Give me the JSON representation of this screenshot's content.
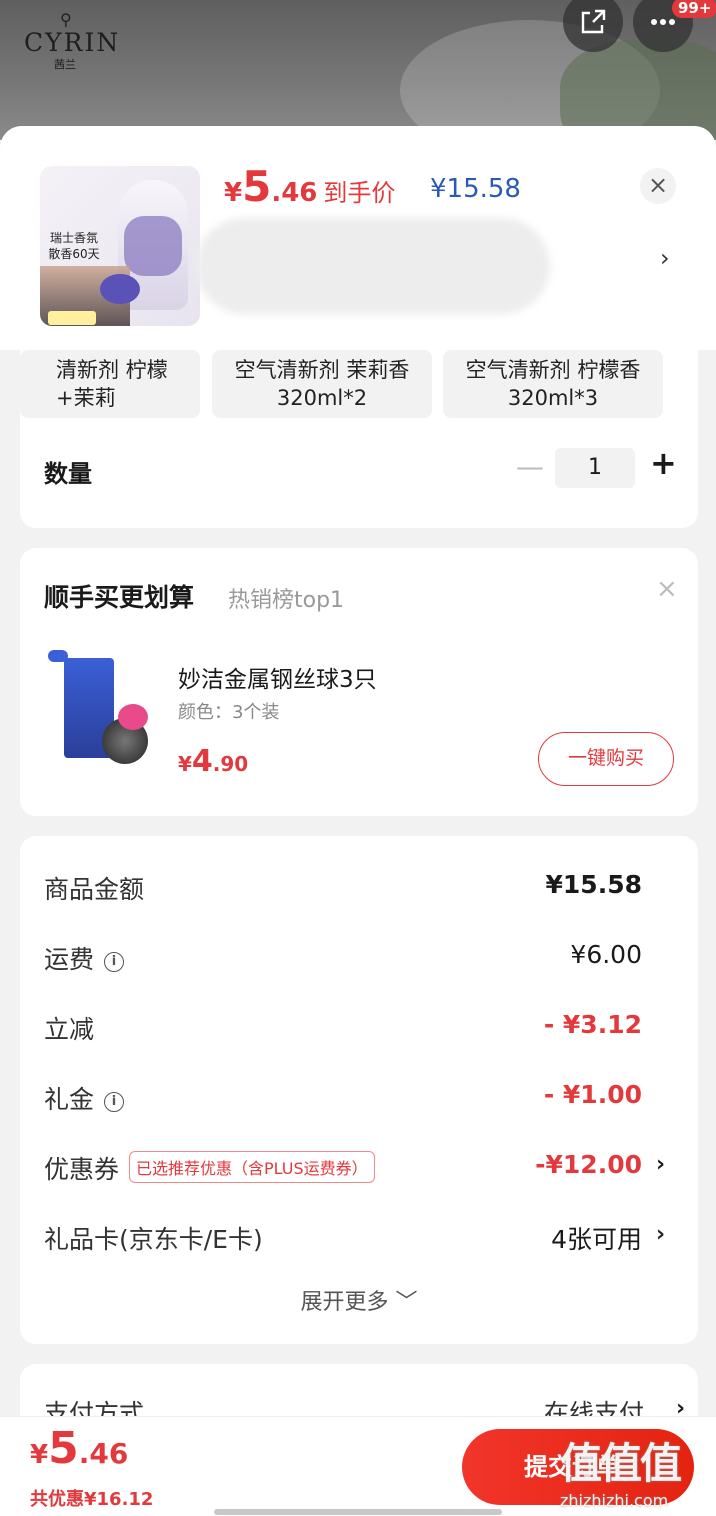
{
  "brand": {
    "name": "CYRIN",
    "sub": "茜兰"
  },
  "top_badge": "99+",
  "header": {
    "price_currency": "¥",
    "price_int": "5",
    "price_dec": ".46",
    "price_label": "到手价",
    "original_price": "¥15.58",
    "close_label": "×",
    "thumb_text": "瑞士香氛 散香60天"
  },
  "spec_options": [
    {
      "label": "清新剂 柠檬+茉莉"
    },
    {
      "label": "空气清新剂 茉莉香320ml*2"
    },
    {
      "label": "空气清新剂 柠檬香320ml*3"
    }
  ],
  "quantity": {
    "label": "数量",
    "value": "1",
    "minus": "—",
    "plus": "+"
  },
  "upsell": {
    "title": "顺手买更划算",
    "subtitle": "热销榜top1",
    "name": "妙洁金属钢丝球3只",
    "attr": "颜色：3个装",
    "price_currency": "¥",
    "price_int": "4",
    "price_dec": ".90",
    "buy_label": "一键购买"
  },
  "summary": {
    "rows": [
      {
        "label": "商品金额",
        "value": "¥15.58"
      },
      {
        "label": "运费",
        "value": "¥6.00"
      },
      {
        "label": "立减",
        "value": "- ¥3.12"
      },
      {
        "label": "礼金",
        "value": "- ¥1.00"
      },
      {
        "label": "优惠券",
        "tag": "已选推荐优惠（含PLUS运费券）",
        "value": "-¥12.00"
      },
      {
        "label": "礼品卡(京东卡/E卡)",
        "value": "4张可用"
      }
    ],
    "expand_label": "展开更多 ﹀"
  },
  "payment": {
    "label": "支付方式",
    "value": "在线支付"
  },
  "bottom": {
    "total_currency": "¥",
    "total_int": "5",
    "total_dec": ".46",
    "saved": "共优惠¥16.12",
    "submit_label": "提交订单"
  },
  "watermark": {
    "big": "值值值",
    "small": "zhizhizhi.com"
  },
  "colors": {
    "accent": "#e4393c",
    "blue_price": "#2a5ab8"
  }
}
